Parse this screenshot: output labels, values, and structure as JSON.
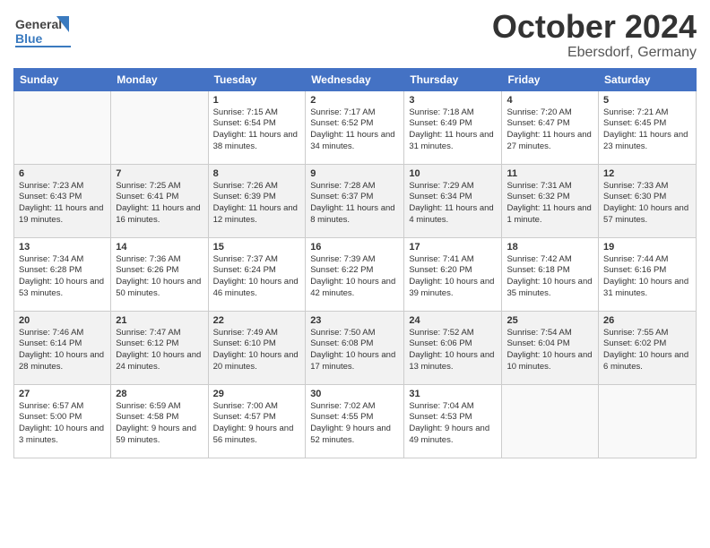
{
  "header": {
    "logo_general": "General",
    "logo_blue": "Blue",
    "title": "October 2024",
    "subtitle": "Ebersdorf, Germany"
  },
  "weekdays": [
    "Sunday",
    "Monday",
    "Tuesday",
    "Wednesday",
    "Thursday",
    "Friday",
    "Saturday"
  ],
  "weeks": [
    [
      {
        "day": "",
        "sunrise": "",
        "sunset": "",
        "daylight": ""
      },
      {
        "day": "",
        "sunrise": "",
        "sunset": "",
        "daylight": ""
      },
      {
        "day": "1",
        "sunrise": "Sunrise: 7:15 AM",
        "sunset": "Sunset: 6:54 PM",
        "daylight": "Daylight: 11 hours and 38 minutes."
      },
      {
        "day": "2",
        "sunrise": "Sunrise: 7:17 AM",
        "sunset": "Sunset: 6:52 PM",
        "daylight": "Daylight: 11 hours and 34 minutes."
      },
      {
        "day": "3",
        "sunrise": "Sunrise: 7:18 AM",
        "sunset": "Sunset: 6:49 PM",
        "daylight": "Daylight: 11 hours and 31 minutes."
      },
      {
        "day": "4",
        "sunrise": "Sunrise: 7:20 AM",
        "sunset": "Sunset: 6:47 PM",
        "daylight": "Daylight: 11 hours and 27 minutes."
      },
      {
        "day": "5",
        "sunrise": "Sunrise: 7:21 AM",
        "sunset": "Sunset: 6:45 PM",
        "daylight": "Daylight: 11 hours and 23 minutes."
      }
    ],
    [
      {
        "day": "6",
        "sunrise": "Sunrise: 7:23 AM",
        "sunset": "Sunset: 6:43 PM",
        "daylight": "Daylight: 11 hours and 19 minutes."
      },
      {
        "day": "7",
        "sunrise": "Sunrise: 7:25 AM",
        "sunset": "Sunset: 6:41 PM",
        "daylight": "Daylight: 11 hours and 16 minutes."
      },
      {
        "day": "8",
        "sunrise": "Sunrise: 7:26 AM",
        "sunset": "Sunset: 6:39 PM",
        "daylight": "Daylight: 11 hours and 12 minutes."
      },
      {
        "day": "9",
        "sunrise": "Sunrise: 7:28 AM",
        "sunset": "Sunset: 6:37 PM",
        "daylight": "Daylight: 11 hours and 8 minutes."
      },
      {
        "day": "10",
        "sunrise": "Sunrise: 7:29 AM",
        "sunset": "Sunset: 6:34 PM",
        "daylight": "Daylight: 11 hours and 4 minutes."
      },
      {
        "day": "11",
        "sunrise": "Sunrise: 7:31 AM",
        "sunset": "Sunset: 6:32 PM",
        "daylight": "Daylight: 11 hours and 1 minute."
      },
      {
        "day": "12",
        "sunrise": "Sunrise: 7:33 AM",
        "sunset": "Sunset: 6:30 PM",
        "daylight": "Daylight: 10 hours and 57 minutes."
      }
    ],
    [
      {
        "day": "13",
        "sunrise": "Sunrise: 7:34 AM",
        "sunset": "Sunset: 6:28 PM",
        "daylight": "Daylight: 10 hours and 53 minutes."
      },
      {
        "day": "14",
        "sunrise": "Sunrise: 7:36 AM",
        "sunset": "Sunset: 6:26 PM",
        "daylight": "Daylight: 10 hours and 50 minutes."
      },
      {
        "day": "15",
        "sunrise": "Sunrise: 7:37 AM",
        "sunset": "Sunset: 6:24 PM",
        "daylight": "Daylight: 10 hours and 46 minutes."
      },
      {
        "day": "16",
        "sunrise": "Sunrise: 7:39 AM",
        "sunset": "Sunset: 6:22 PM",
        "daylight": "Daylight: 10 hours and 42 minutes."
      },
      {
        "day": "17",
        "sunrise": "Sunrise: 7:41 AM",
        "sunset": "Sunset: 6:20 PM",
        "daylight": "Daylight: 10 hours and 39 minutes."
      },
      {
        "day": "18",
        "sunrise": "Sunrise: 7:42 AM",
        "sunset": "Sunset: 6:18 PM",
        "daylight": "Daylight: 10 hours and 35 minutes."
      },
      {
        "day": "19",
        "sunrise": "Sunrise: 7:44 AM",
        "sunset": "Sunset: 6:16 PM",
        "daylight": "Daylight: 10 hours and 31 minutes."
      }
    ],
    [
      {
        "day": "20",
        "sunrise": "Sunrise: 7:46 AM",
        "sunset": "Sunset: 6:14 PM",
        "daylight": "Daylight: 10 hours and 28 minutes."
      },
      {
        "day": "21",
        "sunrise": "Sunrise: 7:47 AM",
        "sunset": "Sunset: 6:12 PM",
        "daylight": "Daylight: 10 hours and 24 minutes."
      },
      {
        "day": "22",
        "sunrise": "Sunrise: 7:49 AM",
        "sunset": "Sunset: 6:10 PM",
        "daylight": "Daylight: 10 hours and 20 minutes."
      },
      {
        "day": "23",
        "sunrise": "Sunrise: 7:50 AM",
        "sunset": "Sunset: 6:08 PM",
        "daylight": "Daylight: 10 hours and 17 minutes."
      },
      {
        "day": "24",
        "sunrise": "Sunrise: 7:52 AM",
        "sunset": "Sunset: 6:06 PM",
        "daylight": "Daylight: 10 hours and 13 minutes."
      },
      {
        "day": "25",
        "sunrise": "Sunrise: 7:54 AM",
        "sunset": "Sunset: 6:04 PM",
        "daylight": "Daylight: 10 hours and 10 minutes."
      },
      {
        "day": "26",
        "sunrise": "Sunrise: 7:55 AM",
        "sunset": "Sunset: 6:02 PM",
        "daylight": "Daylight: 10 hours and 6 minutes."
      }
    ],
    [
      {
        "day": "27",
        "sunrise": "Sunrise: 6:57 AM",
        "sunset": "Sunset: 5:00 PM",
        "daylight": "Daylight: 10 hours and 3 minutes."
      },
      {
        "day": "28",
        "sunrise": "Sunrise: 6:59 AM",
        "sunset": "Sunset: 4:58 PM",
        "daylight": "Daylight: 9 hours and 59 minutes."
      },
      {
        "day": "29",
        "sunrise": "Sunrise: 7:00 AM",
        "sunset": "Sunset: 4:57 PM",
        "daylight": "Daylight: 9 hours and 56 minutes."
      },
      {
        "day": "30",
        "sunrise": "Sunrise: 7:02 AM",
        "sunset": "Sunset: 4:55 PM",
        "daylight": "Daylight: 9 hours and 52 minutes."
      },
      {
        "day": "31",
        "sunrise": "Sunrise: 7:04 AM",
        "sunset": "Sunset: 4:53 PM",
        "daylight": "Daylight: 9 hours and 49 minutes."
      },
      {
        "day": "",
        "sunrise": "",
        "sunset": "",
        "daylight": ""
      },
      {
        "day": "",
        "sunrise": "",
        "sunset": "",
        "daylight": ""
      }
    ]
  ]
}
